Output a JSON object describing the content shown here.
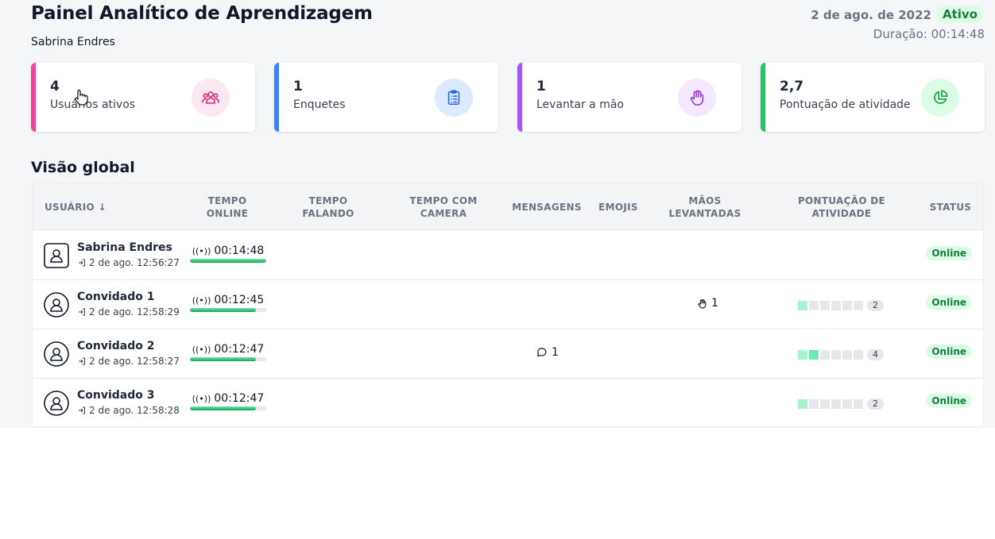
{
  "header": {
    "title": "Painel Analítico de Aprendizagem",
    "user": "Sabrina Endres",
    "date": "2 de ago. de 2022",
    "status": "Ativo",
    "duration": "Duração: 00:14:48"
  },
  "cards": [
    {
      "value": "4",
      "label": "Usuários ativos",
      "icon": "users-icon",
      "accent": "#ec4899",
      "icon_bg": "#fce7f3",
      "icon_color": "#db2777"
    },
    {
      "value": "1",
      "label": "Enquetes",
      "icon": "clipboard-icon",
      "accent": "#3b82f6",
      "icon_bg": "#dbeafe",
      "icon_color": "#2563eb"
    },
    {
      "value": "1",
      "label": "Levantar a mão",
      "icon": "hand-icon",
      "accent": "#a855f7",
      "icon_bg": "#f3e8ff",
      "icon_color": "#9333ea"
    },
    {
      "value": "2,7",
      "label": "Pontuação de atividade",
      "icon": "pie-chart-icon",
      "accent": "#22c55e",
      "icon_bg": "#dcfce7",
      "icon_color": "#16a34a"
    }
  ],
  "section_title": "Visão global",
  "table": {
    "headers": {
      "user": "USUÁRIO ↓",
      "online_1": "TEMPO",
      "online_2": "ONLINE",
      "talking_1": "TEMPO",
      "talking_2": "FALANDO",
      "camera_1": "TEMPO COM",
      "camera_2": "CAMERA",
      "messages": "MENSAGENS",
      "emojis": "EMOJIS",
      "hands_1": "MÃOS",
      "hands_2": "LEVANTADAS",
      "score_1": "PONTUAÇÃO DE",
      "score_2": "ATIVIDADE",
      "status": "STATUS"
    },
    "rows": [
      {
        "name": "Sabrina Endres",
        "joined": "2 de ago. 12:56:27",
        "online": "00:14:48",
        "online_fraction": 1.0,
        "messages": "",
        "hands": "",
        "score_level": 0,
        "score": "",
        "status": "Online"
      },
      {
        "name": "Convidado 1",
        "joined": "2 de ago. 12:58:29",
        "online": "00:12:45",
        "online_fraction": 0.86,
        "messages": "",
        "hands": "1",
        "score_level": 1,
        "score": "2",
        "status": "Online"
      },
      {
        "name": "Convidado 2",
        "joined": "2 de ago. 12:58:27",
        "online": "00:12:47",
        "online_fraction": 0.86,
        "messages": "1",
        "hands": "",
        "score_level": 2,
        "score": "4",
        "status": "Online"
      },
      {
        "name": "Convidado 3",
        "joined": "2 de ago. 12:58:28",
        "online": "00:12:47",
        "online_fraction": 0.86,
        "messages": "",
        "hands": "",
        "score_level": 1,
        "score": "2",
        "status": "Online"
      }
    ]
  }
}
